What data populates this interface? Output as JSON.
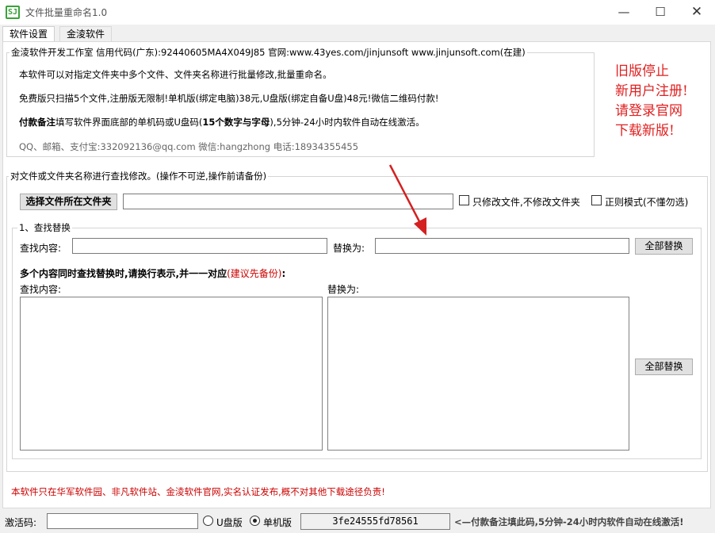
{
  "window": {
    "title": "文件批量重命名1.0",
    "icon": "si-logo-icon"
  },
  "tabs": [
    {
      "label": "软件设置",
      "active": true
    },
    {
      "label": "金淩软件",
      "active": false
    }
  ],
  "info": {
    "legend": "金淩软件开发工作室 信用代码(广东):92440605MA4X049J85 官网:www.43yes.com/jinjunsoft  www.jinjunsoft.com(在建)",
    "line1": "本软件可以对指定文件夹中多个文件、文件夹名称进行批量修改,批量重命名。",
    "line2": "免费版只扫描5个文件,注册版无限制!单机版(绑定电脑)38元,U盘版(绑定自备U盘)48元!微信二维码付款!",
    "line3_bold": "付款备注",
    "line3_mid": "填写软件界面底部的单机码或U盘码(",
    "line3_bold2": "15个数字与字母",
    "line3_end": "),5分钟-24小时内软件自动在线激活。",
    "contact": "QQ、邮箱、支付宝:332092136@qq.com    微信:hangzhong    电话:18934355455"
  },
  "promo": {
    "lines": [
      "旧版停止",
      "新用户注册!",
      "请登录官网",
      "下载新版!"
    ]
  },
  "main_group": {
    "legend": "对文件或文件夹名称进行查找修改。(操作不可逆,操作前请备份)",
    "choose_folder_label": "选择文件所在文件夹",
    "folder_path": "",
    "only_files_label": "只修改文件,不修改文件夹",
    "regex_label": "正则模式(不懂勿选)"
  },
  "find_replace": {
    "legend": "1、查找替换",
    "find_label": "查找内容:",
    "find_value": "",
    "replace_label": "替换为:",
    "replace_value": "",
    "replace_all_label": "全部替换",
    "multi_title": "多个内容同时查找替换时,请换行表示,并一一对应",
    "multi_note": "(建议先备份)",
    "multi_colon": ":",
    "multi_find_label": "查找内容:",
    "multi_replace_label": "替换为:",
    "multi_replace_all_label": "全部替换"
  },
  "notice": "本软件只在华军软件园、非凡软件站、金淩软件官网,实名认证发布,概不对其他下载途径负责!",
  "status": {
    "activation_label": "激活码:",
    "activation_value": "",
    "usb_label": "U盘版",
    "single_label": "单机版",
    "selected": "单机版",
    "machine_code": "3fe24555fd78561",
    "hint": "<—付款备注填此码,5分钟-24小时内软件自动在线激活!"
  },
  "colors": {
    "promo_red": "#e02020",
    "note_red": "#c00000",
    "arrow_red": "#d42020",
    "tab_bg": "#ffffff"
  }
}
